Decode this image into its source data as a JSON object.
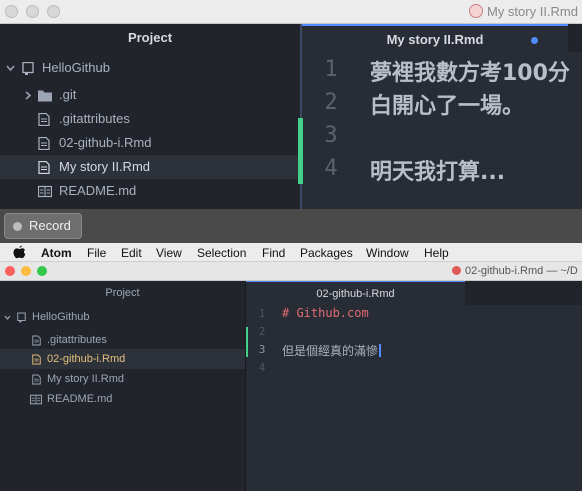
{
  "top_window": {
    "title": "My story II.Rmd",
    "tree": {
      "header": "Project",
      "items": [
        {
          "label": "HelloGithub",
          "kind": "repo"
        },
        {
          "label": ".git",
          "kind": "folder"
        },
        {
          "label": ".gitattributes",
          "kind": "file"
        },
        {
          "label": "02-github-i.Rmd",
          "kind": "file"
        },
        {
          "label": "My story II.Rmd",
          "kind": "file",
          "selected": true
        },
        {
          "label": "README.md",
          "kind": "markdown"
        }
      ]
    },
    "editor": {
      "tab_label": "My story II.Rmd",
      "modified": true,
      "lines": [
        {
          "num": "1",
          "text": "夢裡我數方考100分"
        },
        {
          "num": "2",
          "text": "白開心了一場。"
        },
        {
          "num": "3",
          "text": ""
        },
        {
          "num": "4",
          "text": "明天我打算..."
        }
      ]
    }
  },
  "record_bar": {
    "button_label": "Record"
  },
  "menubar": {
    "app_name": "Atom",
    "items": [
      "File",
      "Edit",
      "View",
      "Selection",
      "Find",
      "Packages",
      "Window",
      "Help"
    ]
  },
  "bottom_window": {
    "title": "02-github-i.Rmd — ~/D",
    "tree": {
      "header": "Project",
      "items": [
        {
          "label": "HelloGithub",
          "kind": "repo"
        },
        {
          "label": ".gitattributes",
          "kind": "file"
        },
        {
          "label": "02-github-i.Rmd",
          "kind": "file",
          "selected": true
        },
        {
          "label": "My story II.Rmd",
          "kind": "file"
        },
        {
          "label": "README.md",
          "kind": "markdown"
        }
      ]
    },
    "editor": {
      "tab_label": "02-github-i.Rmd",
      "lines": [
        {
          "num": "1",
          "text": "# Github.com"
        },
        {
          "num": "2",
          "text": ""
        },
        {
          "num": "3",
          "text": "但是個經真的滿慘"
        },
        {
          "num": "4",
          "text": ""
        }
      ]
    }
  },
  "colors": {
    "heading": "#e06c75",
    "accent": "#528bff",
    "git_added": "#43d08a",
    "selected_file": "#e5c07b"
  }
}
